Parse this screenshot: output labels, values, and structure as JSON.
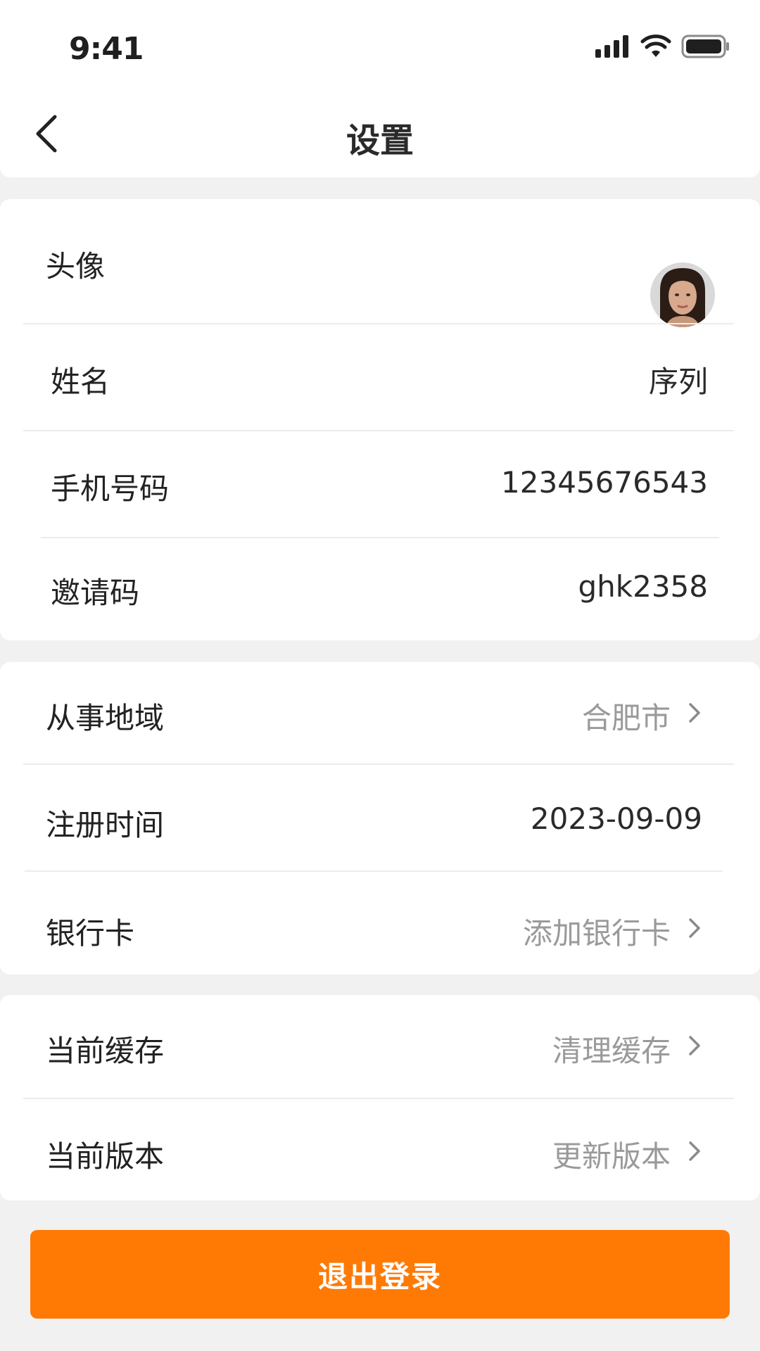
{
  "status_bar": {
    "time": "9:41",
    "icons": [
      "signal-icon",
      "wifi-icon",
      "battery-icon"
    ]
  },
  "nav": {
    "title": "设置",
    "back_icon": "chevron-left-icon"
  },
  "profile": {
    "avatar_label": "头像",
    "name_label": "姓名",
    "name_value": "序列",
    "phone_label": "手机号码",
    "phone_value": "12345676543",
    "invite_label": "邀请码",
    "invite_value": "ghk2358"
  },
  "account": {
    "region_label": "从事地域",
    "region_value": "合肥市",
    "register_label": "注册时间",
    "register_value": "2023-09-09",
    "bank_label": "银行卡",
    "bank_value": "添加银行卡"
  },
  "app": {
    "cache_label": "当前缓存",
    "cache_value": "清理缓存",
    "version_label": "当前版本",
    "version_value": "更新版本"
  },
  "logout_label": "退出登录",
  "colors": {
    "accent": "#ff7a05",
    "background": "#f1f1f1",
    "muted_text": "#9a9a9a"
  }
}
